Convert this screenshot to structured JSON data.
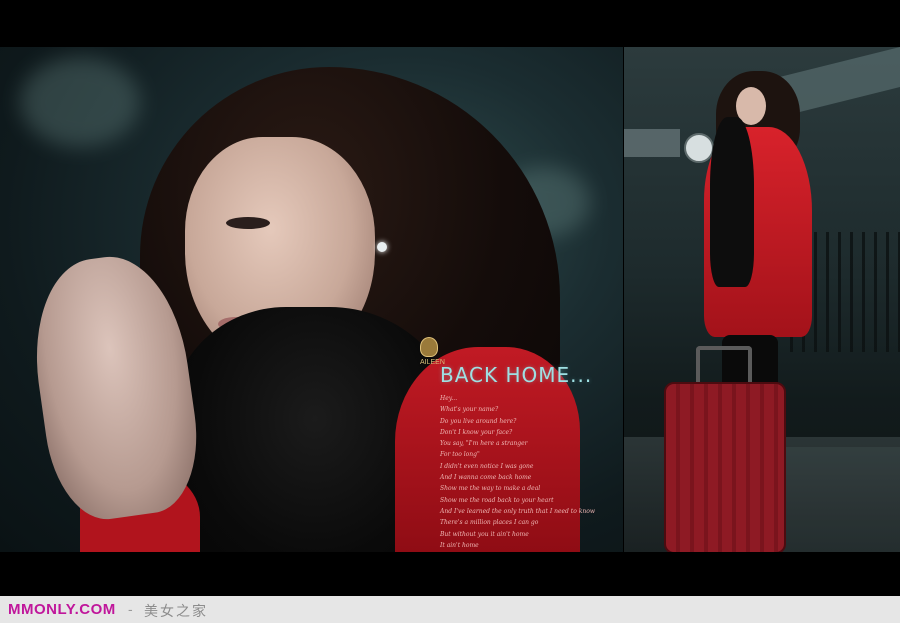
{
  "photo_left": {
    "logo": {
      "icon": "crest-icon",
      "vertical_text": "AILEEN"
    },
    "title": "BACK HOME...",
    "poem_lines": [
      "Hey...",
      "What's your name?",
      "Do you live around here?",
      "Don't I know your face?",
      "You say, \"I'm here a stranger",
      "For too long\"",
      "I didn't even notice I was gone",
      "And I wanna come back home",
      "Show me the way to make a deal",
      "Show me the road back to your heart",
      "And I've learned the only truth that I need to know",
      "There's a million places I can go",
      "But without you it ain't home",
      "It ain't home"
    ]
  },
  "footer": {
    "site": "MMONLY.COM",
    "dash": "-",
    "subtitle": "美女之家"
  },
  "colors": {
    "site": "#c0169b",
    "title": "#9fe0e3",
    "coat_red": "#c11a24"
  }
}
